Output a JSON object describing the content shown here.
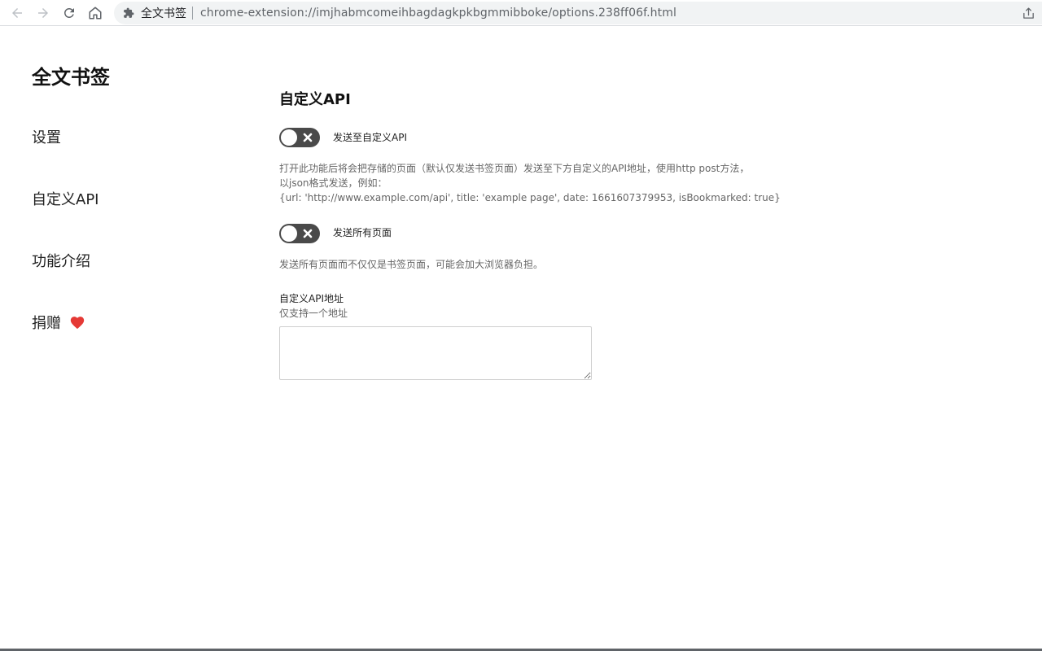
{
  "browser": {
    "extension_name": "全文书签",
    "url": "chrome-extension://imjhabmcomeihbagdagkpkbgmmibboke/options.238ff06f.html",
    "icons": [
      "back-icon",
      "forward-icon",
      "reload-icon",
      "home-icon",
      "puzzle-icon",
      "share-icon"
    ]
  },
  "sidebar": {
    "brand": "全文书签",
    "items": [
      {
        "label": "设置"
      },
      {
        "label": "自定义API"
      },
      {
        "label": "功能介绍"
      },
      {
        "label": "捐赠",
        "icon": "heart-icon"
      }
    ]
  },
  "main": {
    "title": "自定义API",
    "toggle_api": {
      "label": "发送至自定义API",
      "checked": false,
      "description_lines": [
        "打开此功能后将会把存储的页面（默认仅发送书签页面）发送至下方自定义的API地址，使用http post方法，",
        "以json格式发送，例如：",
        "{url: 'http://www.example.com/api', title: 'example page', date: 1661607379953, isBookmarked: true}"
      ]
    },
    "toggle_all": {
      "label": "发送所有页面",
      "checked": false,
      "description": "发送所有页面而不仅仅是书签页面，可能会加大浏览器负担。"
    },
    "api_field": {
      "label": "自定义API地址",
      "hint": "仅支持一个地址",
      "value": ""
    }
  },
  "colors": {
    "toggle_off": "#4a4a4a",
    "heart": "#e53935",
    "description_text": "#666666"
  }
}
